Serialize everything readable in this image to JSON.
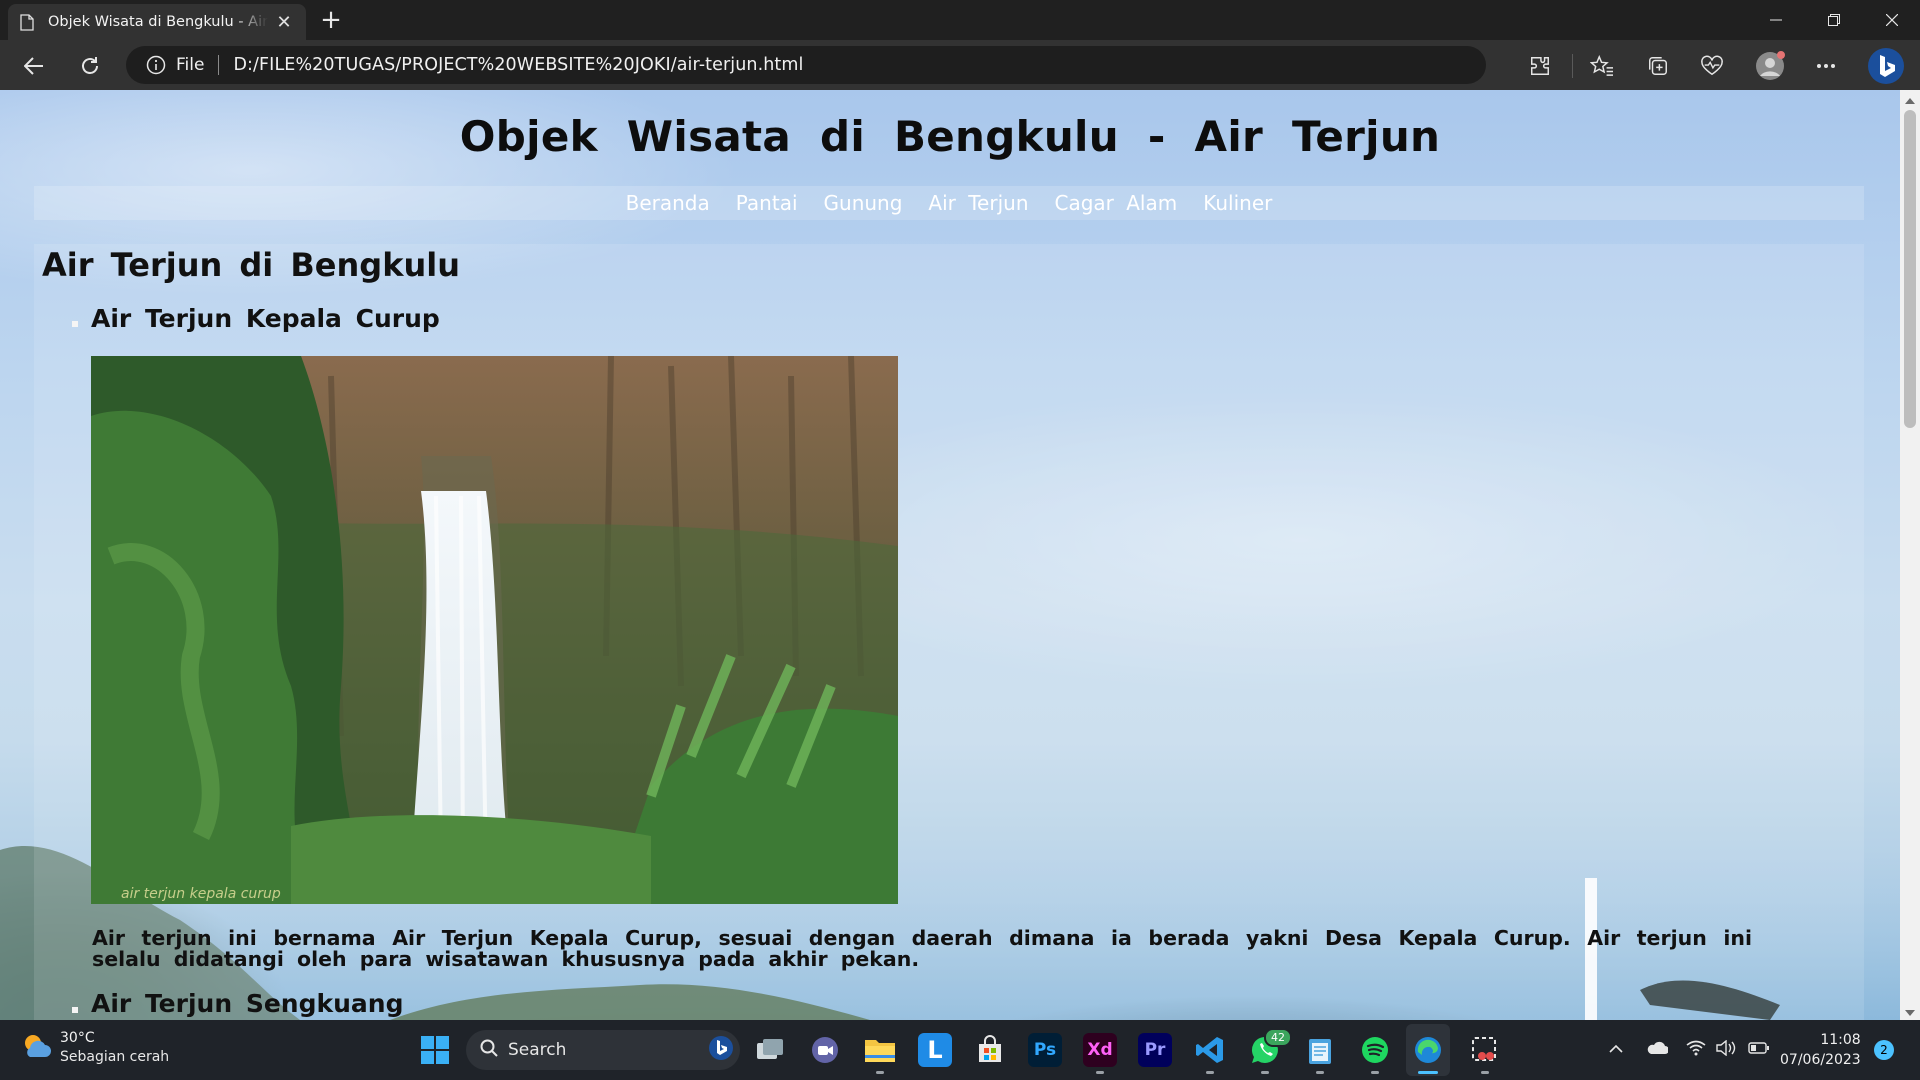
{
  "browser": {
    "tab_title": "Objek Wisata di Bengkulu - Air Terjun",
    "new_tab_label": "+",
    "close_tab_label": "✕",
    "address_scheme": "File",
    "address_url": "D:/FILE%20TUGAS/PROJECT%20WEBSITE%20JOKI/air-terjun.html"
  },
  "page": {
    "title": "Objek Wisata di Bengkulu - Air Terjun",
    "nav": [
      "Beranda",
      "Pantai",
      "Gunung",
      "Air Terjun",
      "Cagar Alam",
      "Kuliner"
    ],
    "section_heading": "Air Terjun di Bengkulu",
    "items": [
      {
        "title": "Air Terjun Kepala Curup",
        "image_caption": "air terjun kepala curup",
        "description": "Air terjun ini bernama Air Terjun Kepala Curup, sesuai dengan daerah dimana ia berada yakni Desa Kepala Curup. Air terjun ini selalu didatangi oleh para wisatawan khususnya pada akhir pekan."
      },
      {
        "title": "Air Terjun Sengkuang"
      }
    ]
  },
  "taskbar": {
    "weather_temp": "30°C",
    "weather_desc": "Sebagian cerah",
    "search_label": "Search",
    "whatsapp_badge": "42",
    "time": "11:08",
    "date": "07/06/2023",
    "notification_count": "2"
  },
  "icons": {
    "ps_label": "Ps",
    "xd_label": "Xd",
    "pr_label": "Pr",
    "l_label": "L"
  }
}
